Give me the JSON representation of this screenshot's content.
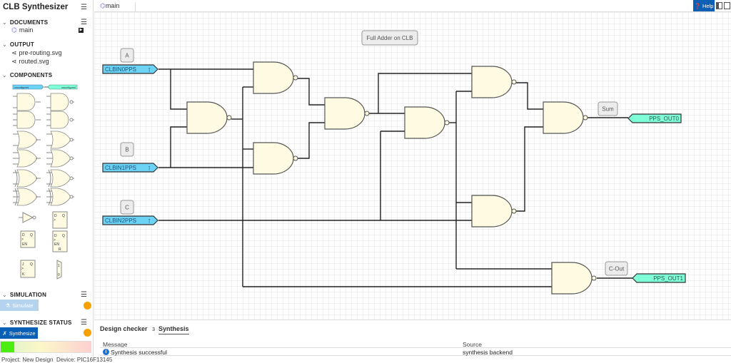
{
  "app": {
    "title": "CLB Synthesizer"
  },
  "sidebar": {
    "documents": {
      "label": "DOCUMENTS",
      "items": [
        {
          "label": "main",
          "icon": "circuit-icon"
        }
      ]
    },
    "output": {
      "label": "OUTPUT",
      "items": [
        {
          "label": "pre-routing.svg",
          "icon": "share-icon"
        },
        {
          "label": "routed.svg",
          "icon": "share-icon"
        }
      ]
    },
    "components": {
      "label": "COMPONENTS",
      "pin_in_label": "unconfigured",
      "pin_out_label": "unconfigured",
      "items": [
        "input-pin",
        "output-pin",
        "and2",
        "nand2",
        "and3",
        "nand3",
        "or2",
        "nor2",
        "or3",
        "nor3",
        "xor2",
        "xnor2",
        "xor3",
        "xnor3",
        "not",
        "d-flip-flop",
        "d-latch-en",
        "d-flip-flop-en-r",
        "jk-flip-flop",
        "mux"
      ],
      "glyphs": {
        "d": "D",
        "q": "Q",
        "en": "EN",
        "r": "R",
        "j": "J",
        "k": "K",
        "one": "1",
        "zero": "0"
      }
    },
    "simulation": {
      "label": "SIMULATION",
      "button": "Simulate",
      "button_enabled": false,
      "status_color": "#f7a100"
    },
    "synthesize": {
      "label": "SYNTHESIZE STATUS",
      "button": "Synthesize",
      "status_color": "#f7a100",
      "progress_percent": 15
    }
  },
  "topbar": {
    "tab": "main",
    "help": "Help"
  },
  "canvas": {
    "title": "Full Adder on CLB",
    "inputs": [
      {
        "name": "CLBIN0PPS",
        "label": "A"
      },
      {
        "name": "CLBIN1PPS",
        "label": "B"
      },
      {
        "name": "CLBIN2PPS",
        "label": "C"
      }
    ],
    "outputs": [
      {
        "name": "PPS_OUT0",
        "label": "Sum"
      },
      {
        "name": "PPS_OUT1",
        "label": "C-Out"
      }
    ],
    "gate_type": "NAND",
    "colors": {
      "input": "#6dd3f5",
      "output": "#7effd8",
      "gate": "#fffbe3"
    }
  },
  "panel": {
    "tabs": [
      {
        "label": "Design checker",
        "count": "3"
      },
      {
        "label": "Synthesis",
        "active": true
      }
    ],
    "columns": [
      "Message",
      "Source"
    ],
    "rows": [
      {
        "message": "Synthesis successful",
        "source": "synthesis backend",
        "icon": "info-icon"
      }
    ]
  },
  "status": {
    "project": "Project: New Design",
    "device": "Device: PIC16F13145"
  }
}
